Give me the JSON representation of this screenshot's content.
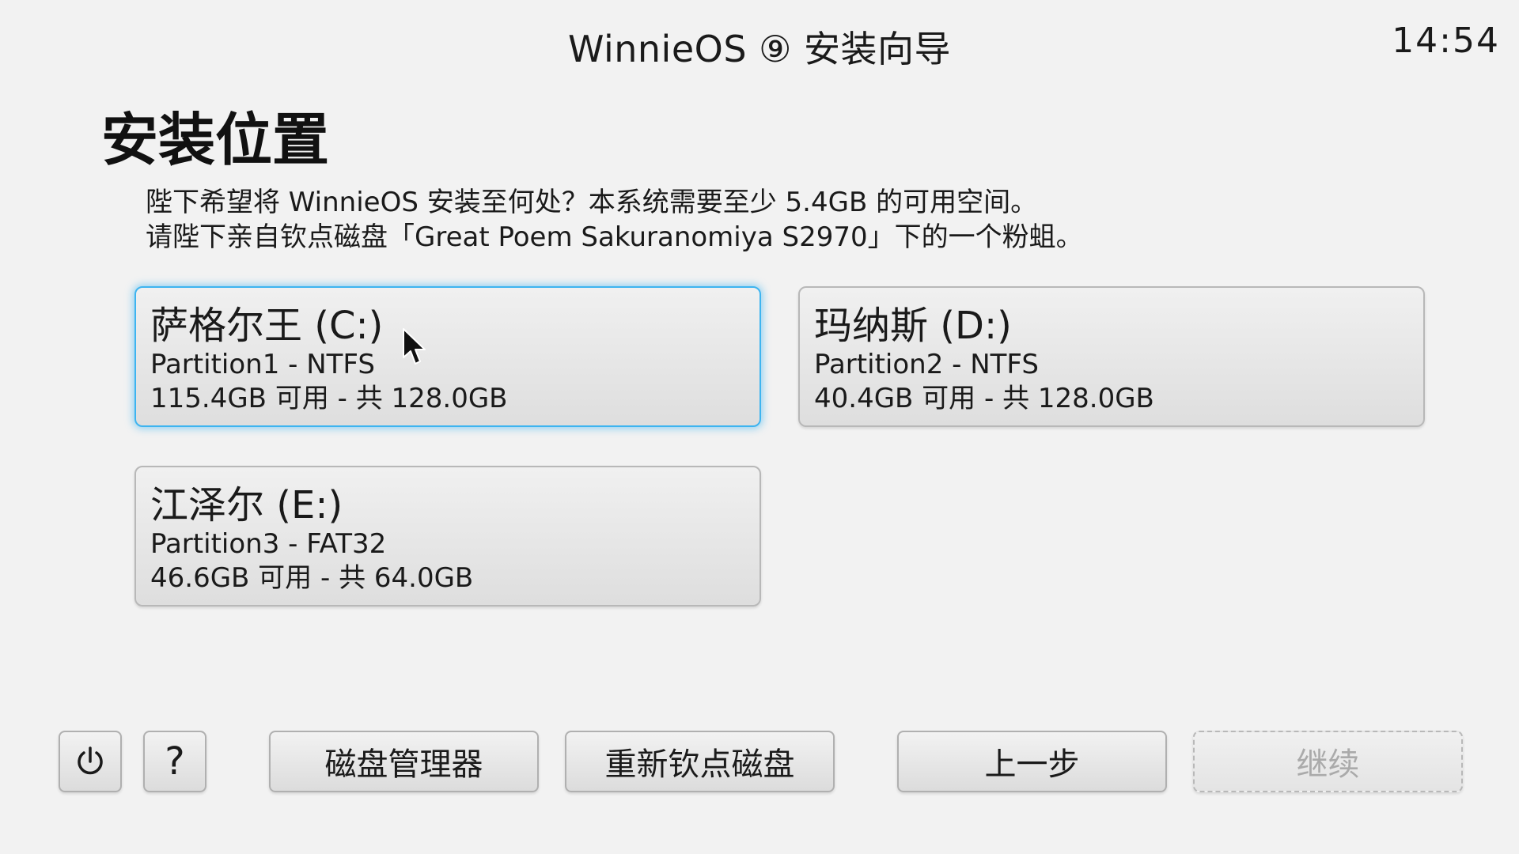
{
  "header": {
    "title": "WinnieOS ⑨ 安装向导",
    "clock": "14:54"
  },
  "main": {
    "title": "安装位置",
    "description_line1": "陛下希望将 WinnieOS 安装至何处？本系统需要至少 5.4GB 的可用空间。",
    "description_line2": "请陛下亲自钦点磁盘「Great Poem Sakuranomiya S2970」下的一个粉蛆。"
  },
  "partitions": [
    {
      "name": "萨格尔王 (C:)",
      "filesystem": "Partition1 - NTFS",
      "size": "115.4GB 可用 - 共 128.0GB",
      "selected": true
    },
    {
      "name": "玛纳斯 (D:)",
      "filesystem": "Partition2 - NTFS",
      "size": "40.4GB 可用 - 共 128.0GB",
      "selected": false
    },
    {
      "name": "江泽尔 (E:)",
      "filesystem": "Partition3 - FAT32",
      "size": "46.6GB 可用 - 共 64.0GB",
      "selected": false
    }
  ],
  "footer": {
    "power_icon": "power-icon",
    "help_label": "?",
    "disk_manager_label": "磁盘管理器",
    "reinsert_label": "重新钦点磁盘",
    "back_label": "上一步",
    "continue_label": "继续",
    "continue_enabled": false
  },
  "colors": {
    "selection_accent": "#3db4f0",
    "background": "#f2f2f2",
    "disabled_text": "#aaaaaa"
  }
}
